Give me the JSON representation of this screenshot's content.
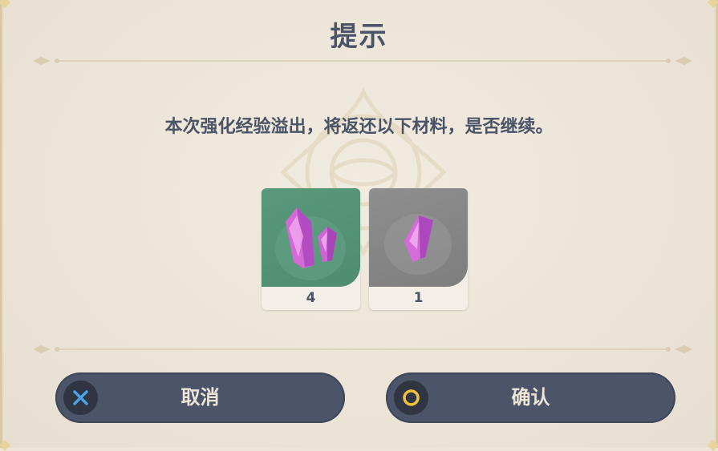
{
  "dialog": {
    "title": "提示",
    "message": "本次强化经验溢出，将返还以下材料，是否继续。"
  },
  "items": [
    {
      "name": "mystic-enhancement-ore",
      "count": "4",
      "rarity": "green"
    },
    {
      "name": "fine-enhancement-ore",
      "count": "1",
      "rarity": "gray"
    }
  ],
  "buttons": {
    "cancel": {
      "label": "取消",
      "icon": "x-button-icon"
    },
    "confirm": {
      "label": "确认",
      "icon": "circle-button-icon"
    }
  },
  "colors": {
    "background": "#ece5d8",
    "text": "#4b5366",
    "button": "#4b5468",
    "green_card": "#59997a",
    "gray_card": "#8e8e8e",
    "cross_icon": "#4aa3e4",
    "circle_icon": "#f0c33c"
  }
}
